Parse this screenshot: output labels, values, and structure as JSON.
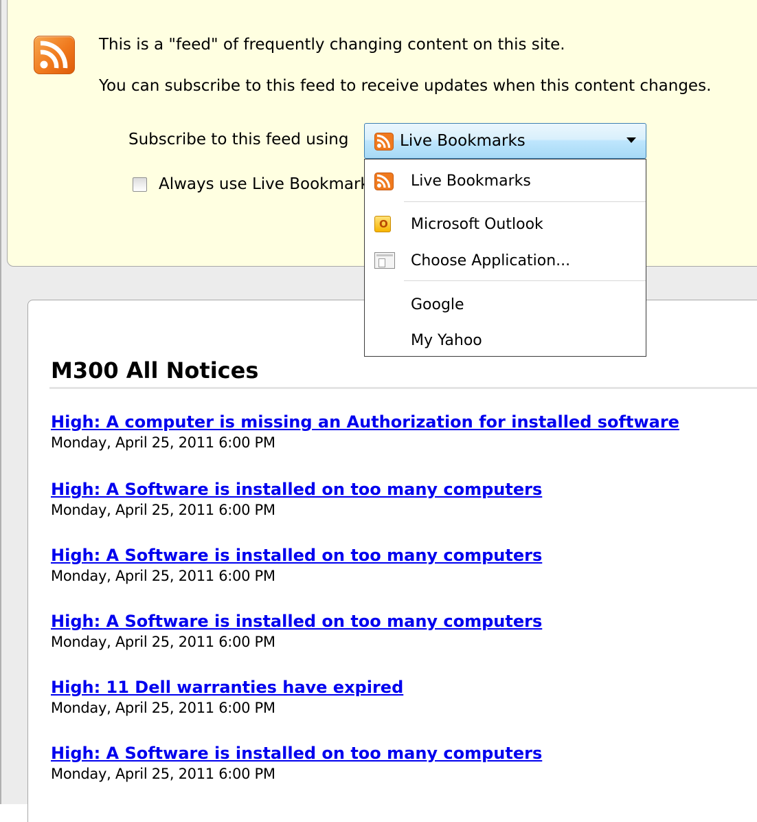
{
  "colors": {
    "header_bg": "#ffffe1",
    "link": "#0000ee",
    "rss_orange": "#f07a1e",
    "dropdown_highlight": "#bee6fd"
  },
  "header": {
    "icon": "rss-feed-icon",
    "intro_line1": "This is a \"feed\" of frequently changing content on this site.",
    "intro_line2": "You can subscribe to this feed to receive updates when this content changes.",
    "subscribe_label": "Subscribe to this feed using",
    "selected_reader": "Live Bookmarks",
    "always_use_label": "Always use Live Bookmarks to subscribe to feeds.",
    "always_use_checked": false
  },
  "reader_menu": {
    "items": [
      {
        "label": "Live Bookmarks",
        "icon": "rss-feed-icon"
      },
      {
        "label": "Microsoft Outlook",
        "icon": "outlook-icon"
      },
      {
        "label": "Choose Application...",
        "icon": "application-icon"
      },
      {
        "label": "Google",
        "icon": ""
      },
      {
        "label": "My Yahoo",
        "icon": ""
      }
    ]
  },
  "feed": {
    "title": "M300 All Notices",
    "entries": [
      {
        "title": "High: A computer is missing an Authorization for installed software",
        "date": "Monday, April 25, 2011 6:00 PM"
      },
      {
        "title": "High: A Software is installed on too many computers",
        "date": "Monday, April 25, 2011 6:00 PM"
      },
      {
        "title": "High: A Software is installed on too many computers",
        "date": "Monday, April 25, 2011 6:00 PM"
      },
      {
        "title": "High: A Software is installed on too many computers",
        "date": "Monday, April 25, 2011 6:00 PM"
      },
      {
        "title": "High: 11 Dell warranties have expired",
        "date": "Monday, April 25, 2011 6:00 PM"
      },
      {
        "title": "High: A Software is installed on too many computers",
        "date": "Monday, April 25, 2011 6:00 PM"
      }
    ]
  }
}
